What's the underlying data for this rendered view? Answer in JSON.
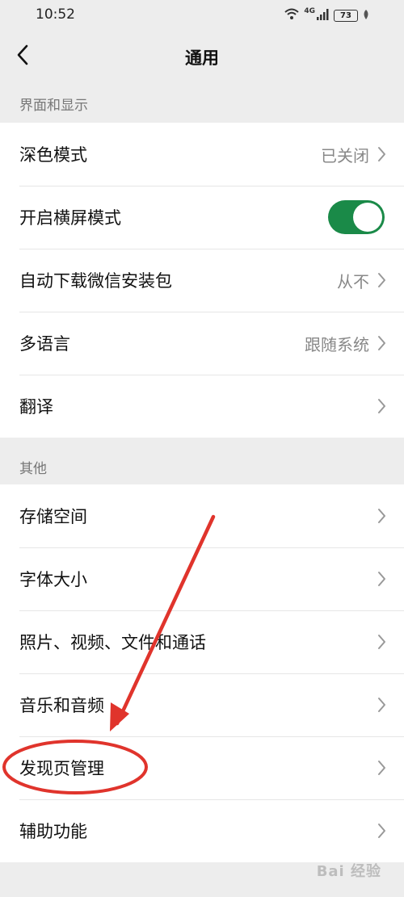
{
  "status_bar": {
    "time": "10:52",
    "network": "4G",
    "battery": "73"
  },
  "nav": {
    "title": "通用"
  },
  "sections": [
    {
      "label": "界面和显示",
      "items": [
        {
          "label": "深色模式",
          "value": "已关闭",
          "chevron": true
        },
        {
          "label": "开启横屏模式",
          "toggle": true,
          "toggle_on": true
        },
        {
          "label": "自动下载微信安装包",
          "value": "从不",
          "chevron": true
        },
        {
          "label": "多语言",
          "value": "跟随系统",
          "chevron": true
        },
        {
          "label": "翻译",
          "value": "",
          "chevron": true
        }
      ]
    },
    {
      "label": "其他",
      "items": [
        {
          "label": "存储空间",
          "chevron": true
        },
        {
          "label": "字体大小",
          "chevron": true
        },
        {
          "label": "照片、视频、文件和通话",
          "chevron": true
        },
        {
          "label": "音乐和音频",
          "chevron": true
        },
        {
          "label": "发现页管理",
          "chevron": true
        },
        {
          "label": "辅助功能",
          "chevron": true
        }
      ]
    }
  ],
  "colors": {
    "toggle_on": "#1a8a48",
    "annotation": "#e0342c",
    "background": "#ededed"
  },
  "watermark": "Bai 经验"
}
